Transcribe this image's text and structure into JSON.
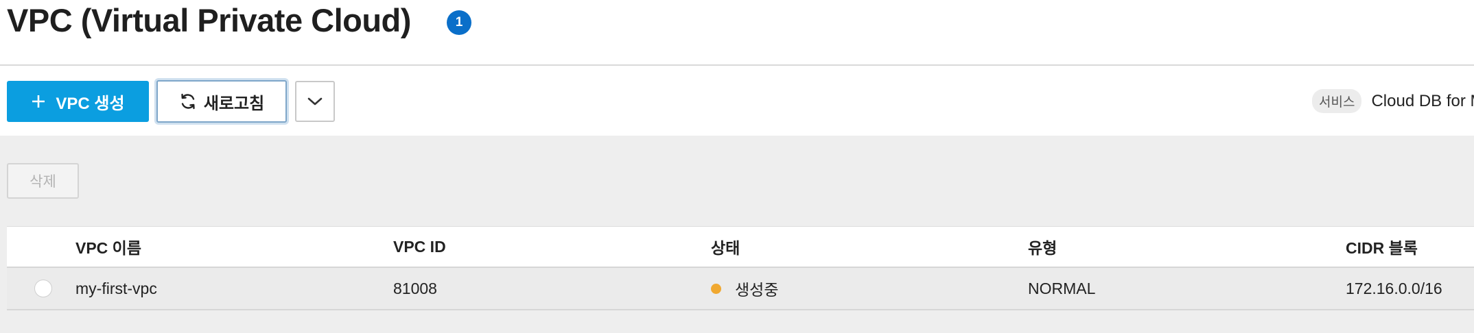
{
  "header": {
    "title": "VPC (Virtual Private Cloud)",
    "count_badge": "1",
    "badge_color": "#0a6fc9"
  },
  "toolbar": {
    "create_label": "VPC 생성",
    "create_icon": "plus-icon",
    "refresh_label": "새로고침",
    "refresh_icon": "refresh-icon",
    "more_icon": "chevron-down-icon",
    "accent_color": "#0b9ee0"
  },
  "service": {
    "tag": "서비스",
    "name": "Cloud DB for M"
  },
  "actions": {
    "delete_label": "삭제"
  },
  "table": {
    "columns": [
      "VPC 이름",
      "VPC ID",
      "상태",
      "유형",
      "CIDR 블록"
    ],
    "rows": [
      {
        "name": "my-first-vpc",
        "id": "81008",
        "status": "생성중",
        "status_color": "#f0a830",
        "type": "NORMAL",
        "cidr": "172.16.0.0/16",
        "selected": false
      }
    ]
  }
}
